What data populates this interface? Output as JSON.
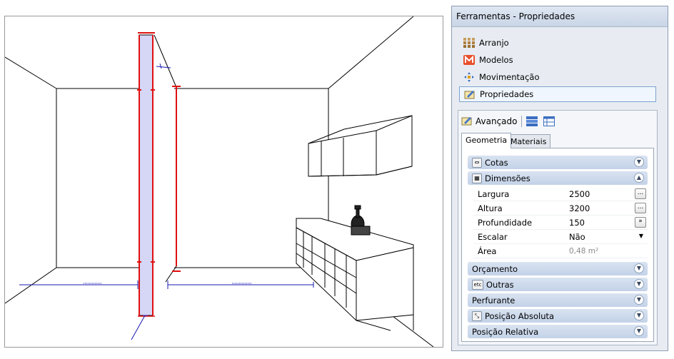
{
  "panel": {
    "title": "Ferramentas - Propriedades",
    "nav": [
      {
        "label": "Arranjo",
        "icon": "arrangement-icon"
      },
      {
        "label": "Modelos",
        "icon": "models-icon"
      },
      {
        "label": "Movimentação",
        "icon": "move-icon"
      },
      {
        "label": "Propriedades",
        "icon": "properties-icon",
        "selected": true
      }
    ],
    "advanced_label": "Avançado",
    "tabs": [
      {
        "label": "Geometria",
        "active": true
      },
      {
        "label": "Materiais",
        "active": false
      }
    ],
    "sections": {
      "cotas": "Cotas",
      "dimensoes": "Dimensões",
      "orcamento": "Orçamento",
      "outras": "Outras",
      "outras_icon_text": "etc",
      "perfurante": "Perfurante",
      "posicao_absoluta": "Posição Absoluta",
      "posicao_relativa": "Posição Relativa"
    },
    "properties": {
      "largura": {
        "name": "Largura",
        "value": "2500"
      },
      "altura": {
        "name": "Altura",
        "value": "3200"
      },
      "profundidade": {
        "name": "Profundidade",
        "value": "150"
      },
      "escalar": {
        "name": "Escalar",
        "value": "Não"
      },
      "area": {
        "name": "Área",
        "value": "0,48 m²"
      }
    },
    "buttons": {
      "ellipsis": "...",
      "expand": "»"
    }
  },
  "colors": {
    "selection_red": "#e01010",
    "wall_fill": "#d6d6f7",
    "dimension_blue": "#1a1ab0",
    "section_header": "#c9d7ea"
  }
}
